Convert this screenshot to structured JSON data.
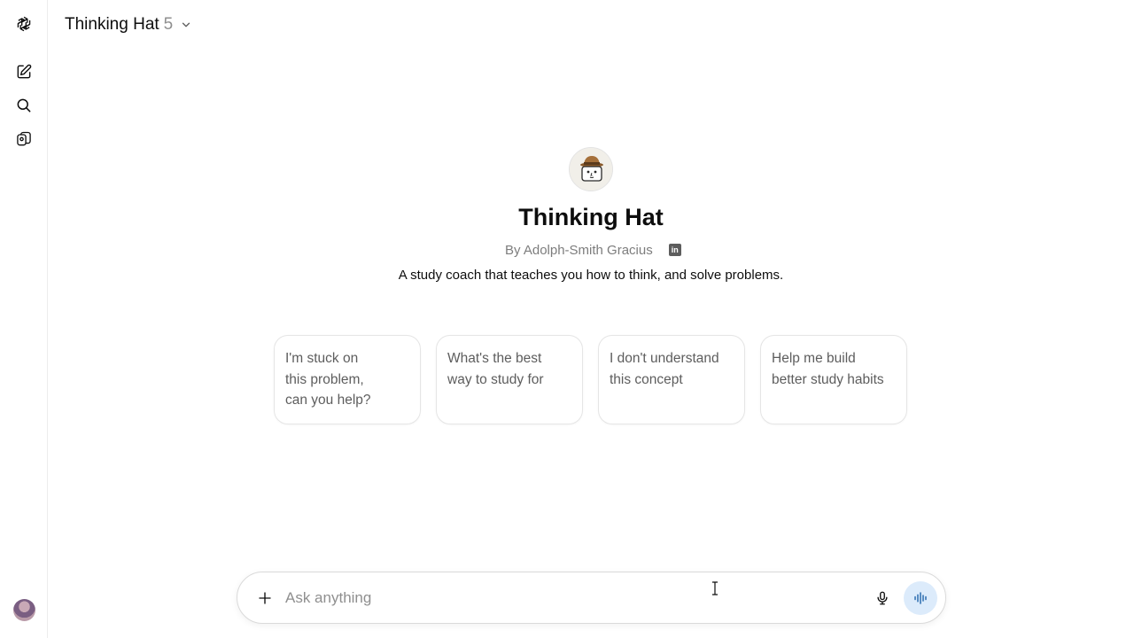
{
  "header": {
    "title": "Thinking Hat",
    "version": "5"
  },
  "sidebar": {
    "items": [
      {
        "name": "logo",
        "icon": "openai-logo-icon"
      },
      {
        "name": "new-chat",
        "icon": "edit-icon"
      },
      {
        "name": "search",
        "icon": "search-icon"
      },
      {
        "name": "gpts",
        "icon": "gpts-icon"
      }
    ]
  },
  "gpt": {
    "name": "Thinking Hat",
    "byline": "By Adolph-Smith Gracius",
    "description": "A study coach that teaches you how to think, and solve problems."
  },
  "starters": [
    {
      "line1": "I'm stuck on",
      "line2": "this problem,",
      "line3": "can you help?"
    },
    {
      "line1": "What's the best",
      "line2": "way to study for",
      "line3": ""
    },
    {
      "line1": "I don't understand",
      "line2": "this concept",
      "line3": ""
    },
    {
      "line1": "Help me build",
      "line2": "better study habits",
      "line3": ""
    }
  ],
  "composer": {
    "placeholder": "Ask anything",
    "value": ""
  },
  "colors": {
    "voice_button_bg": "#dcebfb",
    "voice_icon": "#2b6cb0",
    "text_primary": "#0d0d0d",
    "text_secondary": "#5d5d5d"
  }
}
